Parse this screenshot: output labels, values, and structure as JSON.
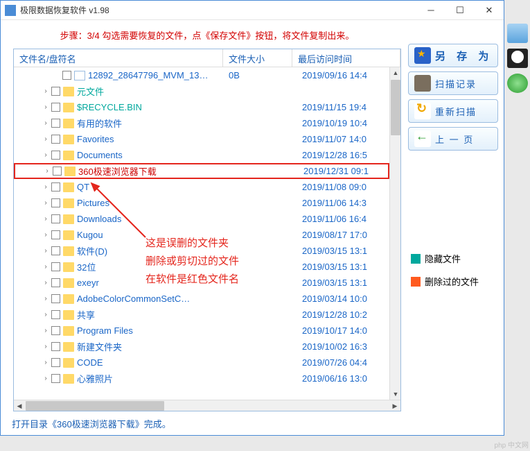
{
  "window": {
    "title": "极限数据恢复软件 v1.98"
  },
  "instructions": "步骤：3/4 勾选需要恢复的文件，点《保存文件》按钮，将文件复制出来。",
  "columns": {
    "name": "文件名/盘符名",
    "size": "文件大小",
    "date": "最后访问时间"
  },
  "files": [
    {
      "type": "file",
      "name": "12892_28647796_MVM_13…",
      "size": "0B",
      "date": "2019/09/16 14:4",
      "expand": "",
      "style": "",
      "indent": 1
    },
    {
      "type": "folder",
      "name": "元文件",
      "size": "",
      "date": "",
      "expand": "›",
      "style": "special",
      "indent": 0
    },
    {
      "type": "folder",
      "name": "$RECYCLE.BIN",
      "size": "",
      "date": "2019/11/15 19:4",
      "expand": "›",
      "style": "special",
      "indent": 0
    },
    {
      "type": "folder",
      "name": "有用的软件",
      "size": "",
      "date": "2019/10/19 10:4",
      "expand": "›",
      "style": "",
      "indent": 0
    },
    {
      "type": "folder",
      "name": "Favorites",
      "size": "",
      "date": "2019/11/07 14:0",
      "expand": "›",
      "style": "",
      "indent": 0
    },
    {
      "type": "folder",
      "name": "Documents",
      "size": "",
      "date": "2019/12/28 16:5",
      "expand": "›",
      "style": "",
      "indent": 0
    },
    {
      "type": "folder",
      "name": "360极速浏览器下载",
      "size": "",
      "date": "2019/12/31 09:1",
      "expand": "›",
      "style": "deleted",
      "indent": 0,
      "highlighted": true
    },
    {
      "type": "folder",
      "name": "QT",
      "size": "",
      "date": "2019/11/08 09:0",
      "expand": "›",
      "style": "",
      "indent": 0
    },
    {
      "type": "folder",
      "name": "Pictures",
      "size": "",
      "date": "2019/11/06 14:3",
      "expand": "›",
      "style": "",
      "indent": 0
    },
    {
      "type": "folder",
      "name": "Downloads",
      "size": "",
      "date": "2019/11/06 16:4",
      "expand": "›",
      "style": "",
      "indent": 0
    },
    {
      "type": "folder",
      "name": "Kugou",
      "size": "",
      "date": "2019/08/17 17:0",
      "expand": "›",
      "style": "",
      "indent": 0
    },
    {
      "type": "folder",
      "name": "软件(D)",
      "size": "",
      "date": "2019/03/15 13:1",
      "expand": "›",
      "style": "",
      "indent": 0
    },
    {
      "type": "folder",
      "name": "32位",
      "size": "",
      "date": "2019/03/15 13:1",
      "expand": "›",
      "style": "",
      "indent": 0
    },
    {
      "type": "folder",
      "name": "exeyr",
      "size": "",
      "date": "2019/03/15 13:1",
      "expand": "›",
      "style": "",
      "indent": 0
    },
    {
      "type": "folder",
      "name": "AdobeColorCommonSetC…",
      "size": "",
      "date": "2019/03/14 10:0",
      "expand": "›",
      "style": "",
      "indent": 0
    },
    {
      "type": "folder",
      "name": "共享",
      "size": "",
      "date": "2019/12/28 10:2",
      "expand": "›",
      "style": "",
      "indent": 0
    },
    {
      "type": "folder",
      "name": "Program Files",
      "size": "",
      "date": "2019/10/17 14:0",
      "expand": "›",
      "style": "",
      "indent": 0
    },
    {
      "type": "folder",
      "name": "新建文件夹",
      "size": "",
      "date": "2019/10/02 16:3",
      "expand": "›",
      "style": "",
      "indent": 0
    },
    {
      "type": "folder",
      "name": "CODE",
      "size": "",
      "date": "2019/07/26 04:4",
      "expand": "›",
      "style": "",
      "indent": 0
    },
    {
      "type": "folder",
      "name": "心雅照片",
      "size": "",
      "date": "2019/06/16 13:0",
      "expand": "›",
      "style": "",
      "indent": 0
    }
  ],
  "buttons": {
    "save": "另 存 为",
    "scanlog": "扫描记录",
    "rescan": "重新扫描",
    "back": "上 一 页"
  },
  "legend": {
    "hidden": "隐藏文件",
    "deleted": "删除过的文件",
    "hidden_color": "#00a89d",
    "deleted_color": "#ff5a1f"
  },
  "annotations": [
    "这是误删的文件夹",
    "删除或剪切过的文件",
    "在软件是红色文件名"
  ],
  "status": "打开目录《360极速浏览器下载》完成。",
  "watermark": "php 中文网"
}
